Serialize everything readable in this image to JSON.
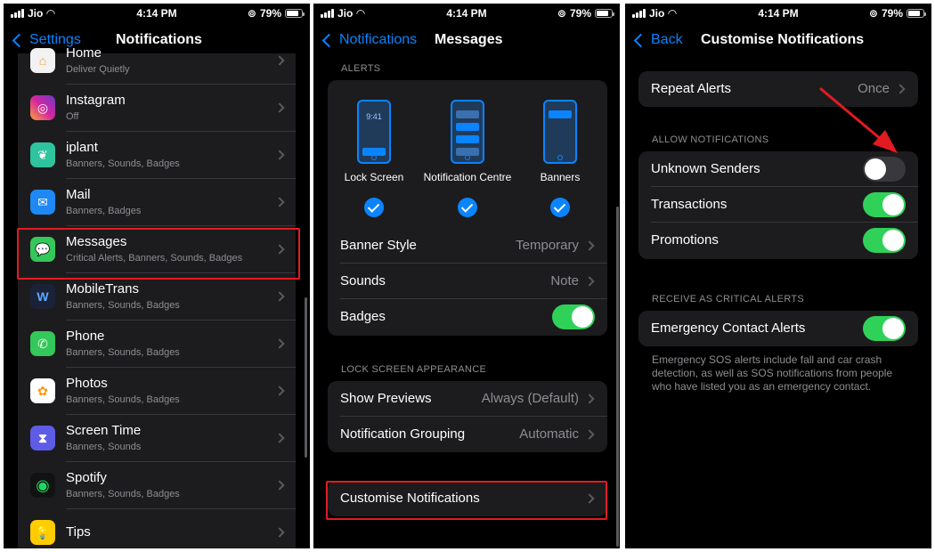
{
  "status_bar": {
    "carrier": "Jio",
    "time": "4:14 PM",
    "battery": "79%"
  },
  "panel1": {
    "back_label": "Settings",
    "title": "Notifications",
    "apps": [
      {
        "name": "Home",
        "detail": "Deliver Quietly",
        "icon": "home-icon",
        "color": "#f2a33a"
      },
      {
        "name": "Instagram",
        "detail": "Off",
        "icon": "instagram-icon",
        "color": "#d6249f"
      },
      {
        "name": "iplant",
        "detail": "Banners, Sounds, Badges",
        "icon": "iplant-icon",
        "color": "#2ec4a0"
      },
      {
        "name": "Mail",
        "detail": "Banners, Badges",
        "icon": "mail-icon",
        "color": "#1e88f5"
      },
      {
        "name": "Messages",
        "detail": "Critical Alerts, Banners, Sounds, Badges",
        "icon": "messages-icon",
        "color": "#34c759"
      },
      {
        "name": "MobileTrans",
        "detail": "Banners, Sounds, Badges",
        "icon": "mobiletrans-icon",
        "color": "#1b2238"
      },
      {
        "name": "Phone",
        "detail": "Banners, Sounds, Badges",
        "icon": "phone-icon",
        "color": "#34c759"
      },
      {
        "name": "Photos",
        "detail": "Banners, Sounds, Badges",
        "icon": "photos-icon",
        "color": "#ffffff"
      },
      {
        "name": "Screen Time",
        "detail": "Banners, Sounds",
        "icon": "hourglass-icon",
        "color": "#5e5ce6"
      },
      {
        "name": "Spotify",
        "detail": "Banners, Sounds, Badges",
        "icon": "spotify-icon",
        "color": "#121212"
      },
      {
        "name": "Tips",
        "detail": "",
        "icon": "lightbulb-icon",
        "color": "#ffcc00"
      }
    ]
  },
  "panel2": {
    "back_label": "Notifications",
    "title": "Messages",
    "alerts_header": "ALERTS",
    "alert_styles": [
      {
        "label": "Lock Screen",
        "checked": true
      },
      {
        "label": "Notification Centre",
        "checked": true
      },
      {
        "label": "Banners",
        "checked": true
      }
    ],
    "lock_time": "9:41",
    "banner_style": {
      "label": "Banner Style",
      "value": "Temporary"
    },
    "sounds": {
      "label": "Sounds",
      "value": "Note"
    },
    "badges": {
      "label": "Badges",
      "on": true
    },
    "lock_screen_header": "LOCK SCREEN APPEARANCE",
    "show_previews": {
      "label": "Show Previews",
      "value": "Always (Default)"
    },
    "grouping": {
      "label": "Notification Grouping",
      "value": "Automatic"
    },
    "customise": {
      "label": "Customise Notifications"
    }
  },
  "panel3": {
    "back_label": "Back",
    "title": "Customise Notifications",
    "repeat_alerts": {
      "label": "Repeat Alerts",
      "value": "Once"
    },
    "allow_header": "ALLOW NOTIFICATIONS",
    "allow_items": [
      {
        "label": "Unknown Senders",
        "on": false
      },
      {
        "label": "Transactions",
        "on": true
      },
      {
        "label": "Promotions",
        "on": true
      }
    ],
    "critical_header": "RECEIVE AS CRITICAL ALERTS",
    "emergency": {
      "label": "Emergency Contact Alerts",
      "on": true
    },
    "footnote": "Emergency SOS alerts include fall and car crash detection, as well as SOS notifications from people who have listed you as an emergency contact."
  },
  "colors": {
    "accent": "#0a84ff",
    "toggle_on": "#30d158",
    "highlight": "#e21b22"
  }
}
